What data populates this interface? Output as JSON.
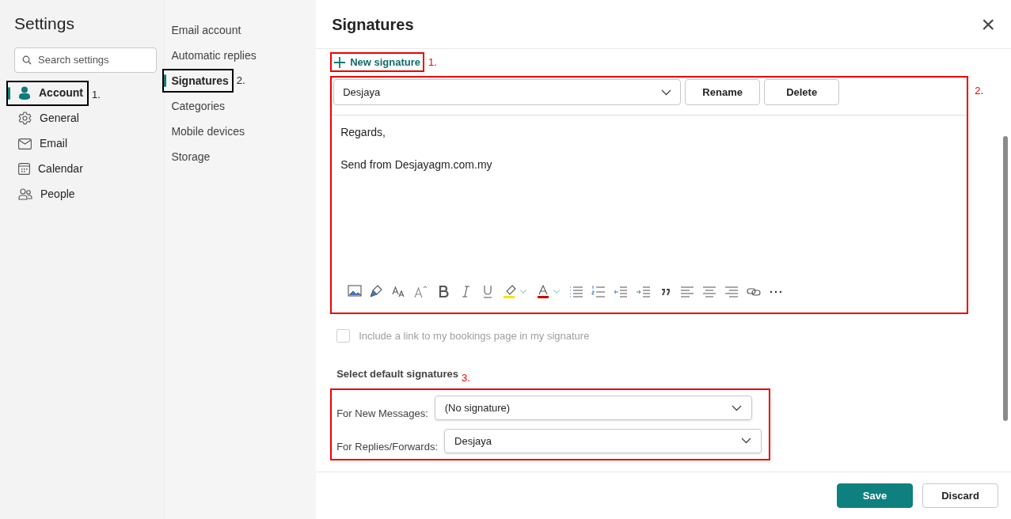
{
  "nav": {
    "title": "Settings",
    "search": {
      "placeholder": "Search settings"
    },
    "items": [
      {
        "label": "Account",
        "selected": true,
        "annotation": "1."
      },
      {
        "label": "General",
        "selected": false
      },
      {
        "label": "Email",
        "selected": false
      },
      {
        "label": "Calendar",
        "selected": false
      },
      {
        "label": "People",
        "selected": false
      }
    ]
  },
  "subnav": {
    "items": [
      {
        "label": "Email account",
        "selected": false
      },
      {
        "label": "Automatic replies",
        "selected": false
      },
      {
        "label": "Signatures",
        "selected": true,
        "annotation": "2."
      },
      {
        "label": "Categories",
        "selected": false
      },
      {
        "label": "Mobile devices",
        "selected": false
      },
      {
        "label": "Storage",
        "selected": false
      }
    ]
  },
  "panel": {
    "title": "Signatures",
    "close": "×",
    "new_signature": {
      "label": "New signature",
      "annotation": "1."
    },
    "editor": {
      "annotation": "2.",
      "signature": "Desjaya",
      "buttons": [
        "Rename",
        "Delete"
      ],
      "lines": [
        "Regards,",
        "Send from Desjayagm.com.my"
      ]
    },
    "bookings": {
      "label": "Include a link to my bookings page in my signature",
      "checked": false,
      "disabled": true
    },
    "defaults": {
      "heading": "Select default signatures",
      "annotation": "3.",
      "fields": [
        {
          "label": "For New Messages:",
          "value": "(No signature)"
        },
        {
          "label": "For Replies/Forwards:",
          "value": "Desjaya"
        }
      ]
    },
    "footer": {
      "buttons": [
        {
          "label": "Save",
          "kind": "primary"
        },
        {
          "label": "Discard",
          "kind": "secondary"
        }
      ]
    }
  }
}
